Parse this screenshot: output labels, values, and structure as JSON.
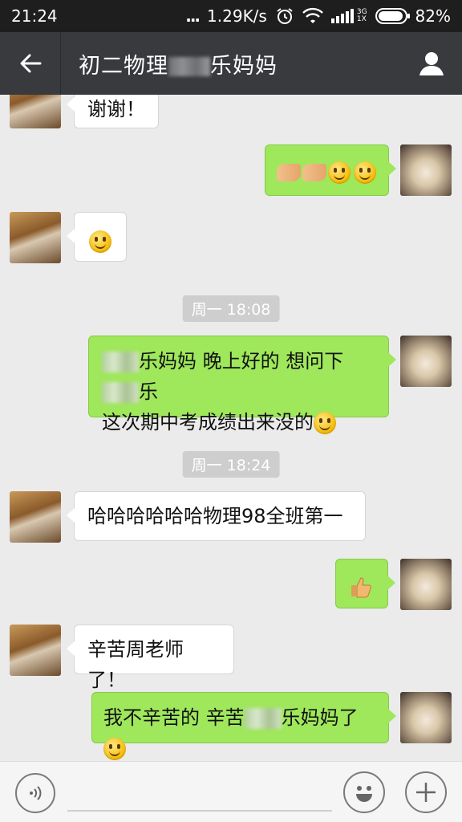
{
  "status_bar": {
    "time": "21:24",
    "dots": "...",
    "network_speed": "1.29K/s",
    "network_type_top": "3G",
    "network_type_bottom": "1X",
    "battery": "82%"
  },
  "header": {
    "title_prefix": "初二物理",
    "title_suffix": "乐妈妈"
  },
  "messages": [
    {
      "id": "m1",
      "side": "in",
      "text": "谢谢！"
    },
    {
      "id": "m2",
      "side": "out",
      "emoji": [
        "handshake",
        "handshake",
        "smile",
        "smile"
      ]
    },
    {
      "id": "m3",
      "side": "in",
      "emoji": [
        "smile"
      ]
    },
    {
      "id": "t1",
      "type": "timestamp",
      "text": "周一 18:08"
    },
    {
      "id": "m4",
      "side": "out",
      "line1_a": "乐妈妈 晚上好的 想问下",
      "line1_b": "乐",
      "line2": "这次期中考成绩出来没的",
      "emoji": [
        "smile"
      ]
    },
    {
      "id": "t2",
      "type": "timestamp",
      "text": "周一 18:24"
    },
    {
      "id": "m5",
      "side": "in",
      "text": "哈哈哈哈哈哈物理98全班第一"
    },
    {
      "id": "m6",
      "side": "out",
      "emoji": [
        "thumbs-up"
      ]
    },
    {
      "id": "m7",
      "side": "in",
      "text": "辛苦周老师了！"
    },
    {
      "id": "m8",
      "side": "out",
      "text_a": "我不辛苦的 辛苦",
      "text_b": "乐妈妈了",
      "emoji": [
        "smile"
      ]
    }
  ],
  "colors": {
    "status_bar_bg": "#1e1e1e",
    "title_bar_bg": "#393a3e",
    "chat_bg": "#ebebeb",
    "outgoing_bubble": "#9fe75b",
    "incoming_bubble": "#ffffff",
    "timestamp_bg": "#cecece"
  },
  "icons": {
    "back": "arrow-left-icon",
    "profile": "person-icon",
    "voice": "voice-icon",
    "emoji": "emoji-icon",
    "more": "plus-icon"
  }
}
